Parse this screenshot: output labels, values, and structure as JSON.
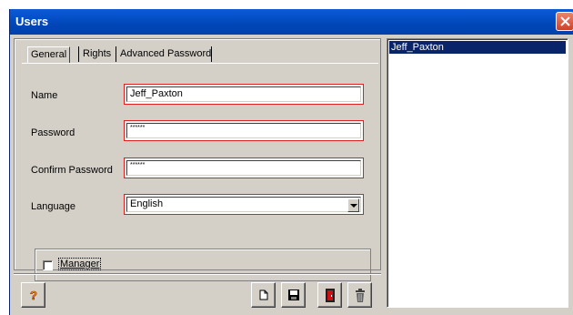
{
  "window": {
    "title": "Users"
  },
  "tabs": [
    {
      "label": "General"
    },
    {
      "label": "Rights"
    },
    {
      "label": "Advanced Password"
    }
  ],
  "form": {
    "name_label": "Name",
    "name_value": "Jeff_Paxton",
    "password_label": "Password",
    "password_value": "******",
    "confirm_label": "Confirm Password",
    "confirm_value": "******",
    "language_label": "Language",
    "language_value": "English",
    "manager_label": "Manager"
  },
  "user_list": {
    "items": [
      "Jeff_Paxton"
    ]
  },
  "toolbar": {
    "icons": [
      "help-icon",
      "new-document-icon",
      "save-icon",
      "exit-door-icon",
      "trash-icon"
    ]
  },
  "colors": {
    "titlebar": "#0047b8",
    "highlight_border": "#e02020",
    "selection": "#0a246a"
  }
}
